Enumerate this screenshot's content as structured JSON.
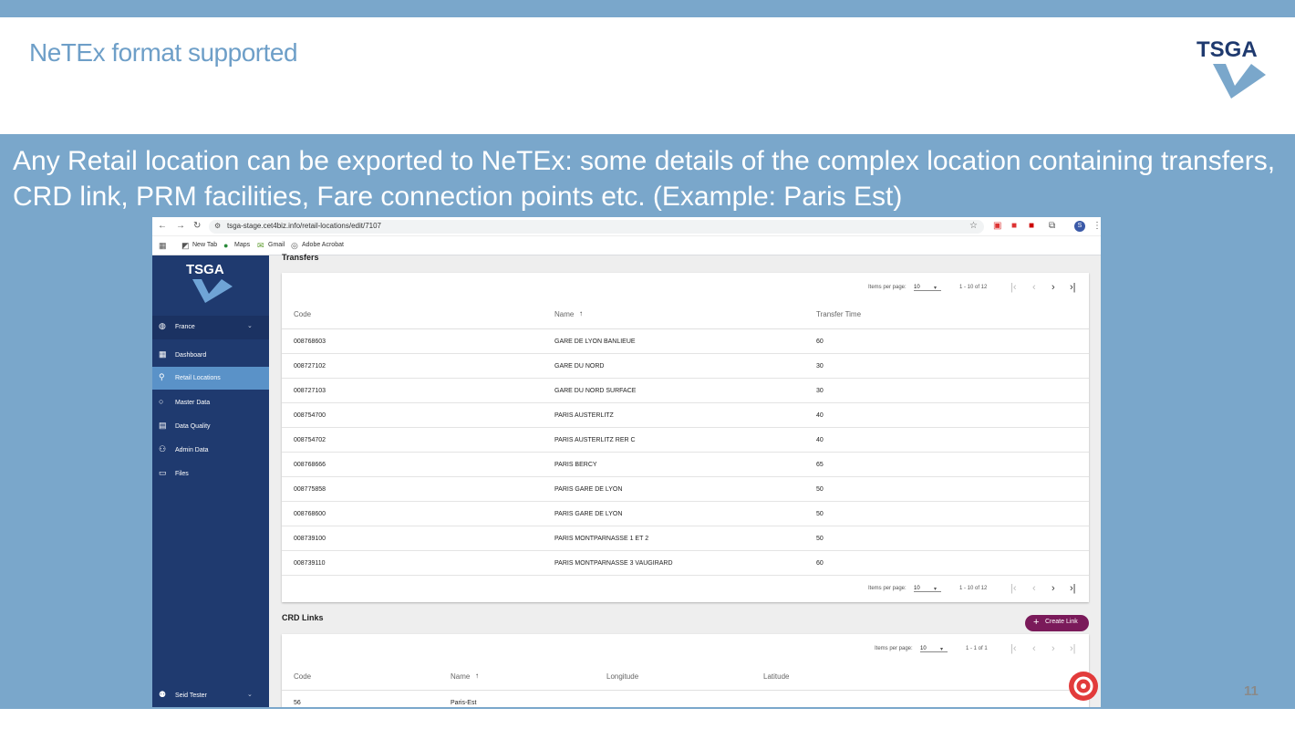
{
  "slide": {
    "title": "NeTEx format supported",
    "subtitle": "Any Retail location can be exported to NeTEx: some details of the complex location containing transfers, CRD link, PRM facilities, Fare connection points etc. (Example: Paris Est)",
    "logo_text": "TSGA",
    "page_number": "11"
  },
  "colors": {
    "band": "#7aa7cb",
    "title": "#6e9fc8",
    "sidebar": "#1f3a6f",
    "sidebar_active": "#5a92c8",
    "create_button": "#7a1a5a"
  },
  "browser": {
    "url": "tsga-stage.cet4biz.info/retail-locations/edit/7107",
    "bookmarks": [
      {
        "label": "New Tab",
        "icon": "new-tab-icon"
      },
      {
        "label": "Maps",
        "icon": "maps-pin-icon"
      },
      {
        "label": "Gmail",
        "icon": "gmail-icon"
      },
      {
        "label": "Adobe Acrobat",
        "icon": "acrobat-icon"
      }
    ],
    "profile_initial": "S"
  },
  "sidebar": {
    "logo_text": "TSGA",
    "country": "France",
    "items": [
      {
        "label": "Dashboard",
        "icon": "dashboard-icon"
      },
      {
        "label": "Retail Locations",
        "icon": "location-pin-icon"
      },
      {
        "label": "Master Data",
        "icon": "circle-icon"
      },
      {
        "label": "Data Quality",
        "icon": "calendar-icon"
      },
      {
        "label": "Admin Data",
        "icon": "people-icon"
      },
      {
        "label": "Files",
        "icon": "folder-icon"
      }
    ],
    "user": "Seid Tester"
  },
  "transfers": {
    "title": "Transfers",
    "pager": {
      "items_label": "Items per page:",
      "page_size": "10",
      "range": "1 - 10 of 12"
    },
    "columns": [
      "Code",
      "Name",
      "Transfer Time"
    ],
    "sort_icon": "↑",
    "rows": [
      {
        "code": "008768603",
        "name": "GARE DE LYON BANLIEUE",
        "time": "60"
      },
      {
        "code": "008727102",
        "name": "GARE DU NORD",
        "time": "30"
      },
      {
        "code": "008727103",
        "name": "GARE DU NORD SURFACE",
        "time": "30"
      },
      {
        "code": "008754700",
        "name": "PARIS AUSTERLITZ",
        "time": "40"
      },
      {
        "code": "008754702",
        "name": "PARIS AUSTERLITZ RER C",
        "time": "40"
      },
      {
        "code": "008768666",
        "name": "PARIS BERCY",
        "time": "65"
      },
      {
        "code": "008775858",
        "name": "PARIS GARE DE LYON",
        "time": "50"
      },
      {
        "code": "008768600",
        "name": "PARIS GARE DE LYON",
        "time": "50"
      },
      {
        "code": "008739100",
        "name": "PARIS MONTPARNASSE 1 ET 2",
        "time": "50"
      },
      {
        "code": "008739110",
        "name": "PARIS MONTPARNASSE 3 VAUGIRARD",
        "time": "60"
      }
    ]
  },
  "crd_links": {
    "title": "CRD Links",
    "create_label": "Create Link",
    "pager": {
      "items_label": "Items per page:",
      "page_size": "10",
      "range": "1 - 1 of 1"
    },
    "columns": [
      "Code",
      "Name",
      "Longitude",
      "Latitude"
    ],
    "sort_icon": "↑",
    "rows": [
      {
        "code": "56",
        "name": "Paris-Est"
      }
    ]
  }
}
